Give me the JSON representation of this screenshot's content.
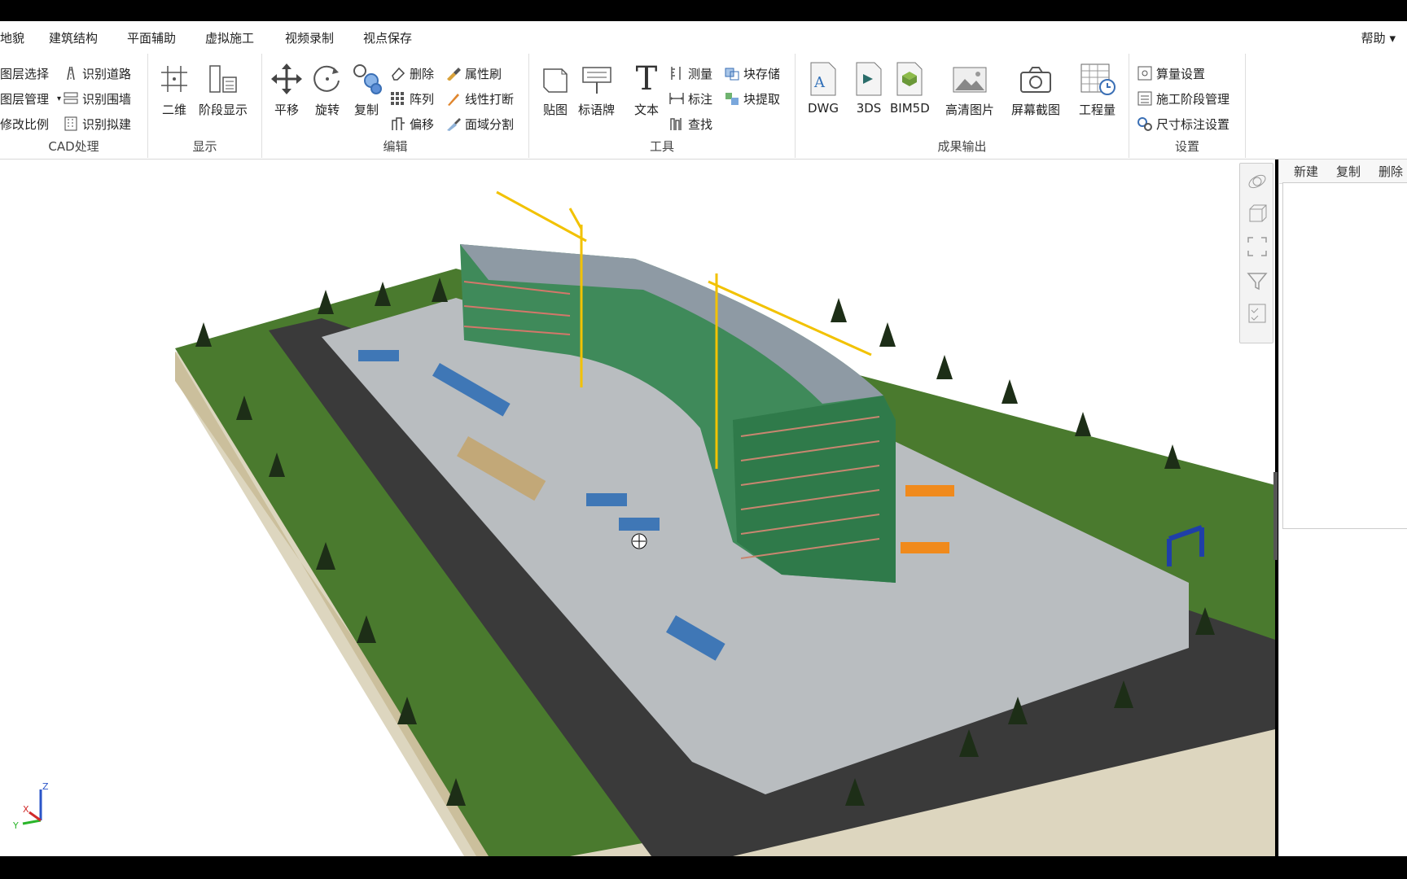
{
  "menu": {
    "tabs": [
      "地貌",
      "建筑结构",
      "平面辅助",
      "虚拟施工",
      "视频录制",
      "视点保存"
    ],
    "help": "帮助"
  },
  "ribbon": {
    "cad": {
      "label": "CAD处理",
      "items": [
        "图层选择",
        "图层管理",
        "修改比例",
        "识别道路",
        "识别围墙",
        "识别拟建"
      ]
    },
    "display": {
      "label": "显示",
      "items": [
        "二维",
        "阶段显示"
      ]
    },
    "edit": {
      "label": "编辑",
      "big": [
        "平移",
        "旋转",
        "复制"
      ],
      "small": [
        "删除",
        "阵列",
        "偏移",
        "属性刷",
        "线性打断",
        "面域分割"
      ]
    },
    "tools": {
      "label": "工具",
      "big": [
        "贴图",
        "标语牌",
        "文本"
      ],
      "small": [
        "测量",
        "标注",
        "查找",
        "块存储",
        "块提取"
      ]
    },
    "output": {
      "label": "成果输出",
      "items": [
        "DWG",
        "3DS",
        "BIM5D",
        "高清图片",
        "屏幕截图",
        "工程量"
      ]
    },
    "settings": {
      "label": "设置",
      "items": [
        "算量设置",
        "施工阶段管理",
        "尺寸标注设置"
      ]
    }
  },
  "side_panel": {
    "buttons": [
      "新建",
      "复制",
      "删除"
    ]
  },
  "axis": {
    "x": "X",
    "y": "Y",
    "z": "Z"
  },
  "colors": {
    "grass": "#4a7a2e",
    "road": "#3a3a3a",
    "site": "#b9bdc0",
    "building": "#3f8a5a",
    "crane": "#f2c200"
  }
}
